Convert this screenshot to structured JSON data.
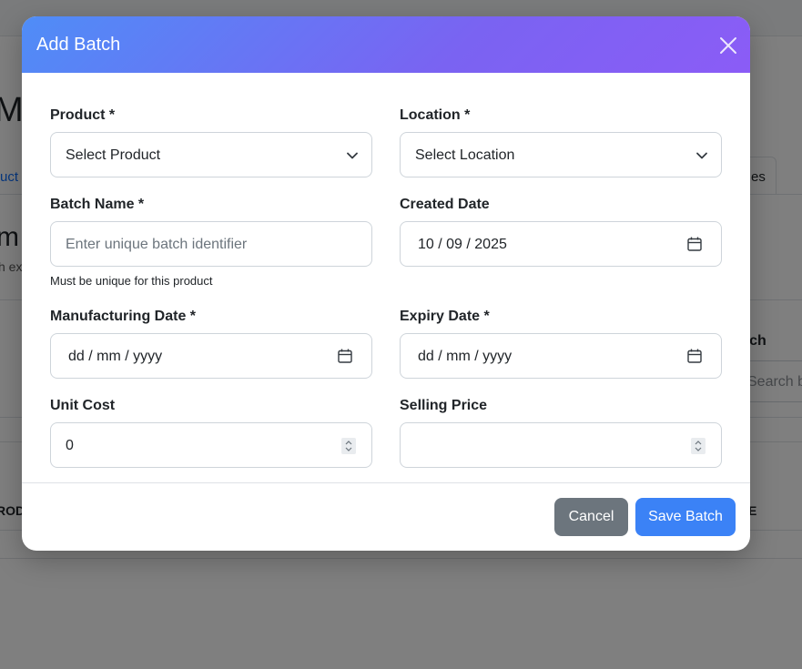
{
  "background": {
    "title": "Ma",
    "tab_link": "uct",
    "tab_right": "es",
    "sub_big": "m",
    "sub_small": "h ex",
    "search_label": "arch",
    "search_placeholder": "Search b",
    "table_header_left": "ROD",
    "table_header_right": "E"
  },
  "modal": {
    "title": "Add Batch",
    "fields": {
      "product": {
        "label": "Product *",
        "value": "Select Product"
      },
      "location": {
        "label": "Location *",
        "value": "Select Location"
      },
      "batch_name": {
        "label": "Batch Name *",
        "placeholder": "Enter unique batch identifier",
        "help": "Must be unique for this product"
      },
      "created_date": {
        "label": "Created Date",
        "value": "10 / 09 / 2025"
      },
      "manufacturing_date": {
        "label": "Manufacturing Date *",
        "value": "dd / mm / yyyy"
      },
      "expiry_date": {
        "label": "Expiry Date *",
        "value": "dd / mm / yyyy"
      },
      "unit_cost": {
        "label": "Unit Cost",
        "value": "0"
      },
      "selling_price": {
        "label": "Selling Price",
        "value": ""
      }
    },
    "buttons": {
      "cancel": "Cancel",
      "save": "Save Batch"
    }
  },
  "colors": {
    "header_gradient_start": "#4f8df7",
    "header_gradient_end": "#8b5cf6",
    "save_button": "#3b82f6",
    "cancel_button": "#6c757d"
  },
  "icons": {
    "close": "close-icon",
    "select": "chevron-down-icon",
    "date": "calendar-icon",
    "number": "spinner-icon"
  }
}
